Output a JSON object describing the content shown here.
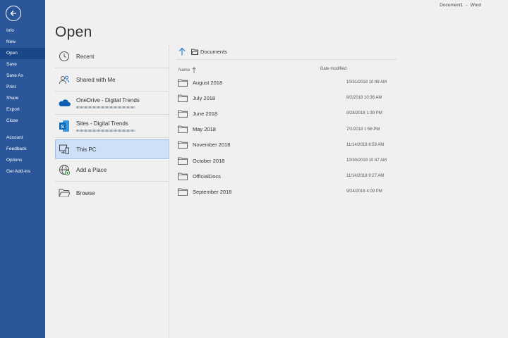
{
  "window": {
    "document": "Document1",
    "separator": "-",
    "app": "Word"
  },
  "nav": {
    "back_icon": "back-arrow-icon",
    "items_top": [
      "Info",
      "New",
      "Open",
      "Save",
      "Save As",
      "Print",
      "Share",
      "Export",
      "Close"
    ],
    "items_bottom": [
      "Account",
      "Feedback",
      "Options",
      "Get Add-ins"
    ],
    "active": "Open",
    "bg_color": "#2b579a"
  },
  "page_title": "Open",
  "locations": [
    {
      "label": "Recent",
      "icon": "clock-icon"
    },
    {
      "label": "Shared with Me",
      "icon": "shared-users-icon"
    },
    {
      "label": "OneDrive - Digital Trends",
      "icon": "onedrive-cloud-icon"
    },
    {
      "label": "Sites - Digital Trends",
      "icon": "sharepoint-icon"
    },
    {
      "label": "This PC",
      "icon": "computer-icon"
    },
    {
      "label": "Add a Place",
      "icon": "globe-icon"
    },
    {
      "label": "Browse",
      "icon": "open-folder-icon"
    }
  ],
  "breadcrumb": {
    "up_icon": "up-arrow-icon",
    "folder_icon": "folder-icon",
    "label": "Documents"
  },
  "columns": {
    "name": "Name",
    "date": "Date modified"
  },
  "files": [
    {
      "name": "August 2018",
      "date": "10/31/2018 10:49 AM"
    },
    {
      "name": "July 2018",
      "date": "8/2/2018 10:36 AM"
    },
    {
      "name": "June 2018",
      "date": "8/28/2018 1:39 PM"
    },
    {
      "name": "May 2018",
      "date": "7/2/2018 1:58 PM"
    },
    {
      "name": "November 2018",
      "date": "11/14/2018 8:59 AM"
    },
    {
      "name": "October 2018",
      "date": "10/30/2018 10:47 AM"
    },
    {
      "name": "OfficialDocs",
      "date": "11/14/2018 9:27 AM"
    },
    {
      "name": "September 2018",
      "date": "9/24/2018 4:09 PM"
    }
  ]
}
